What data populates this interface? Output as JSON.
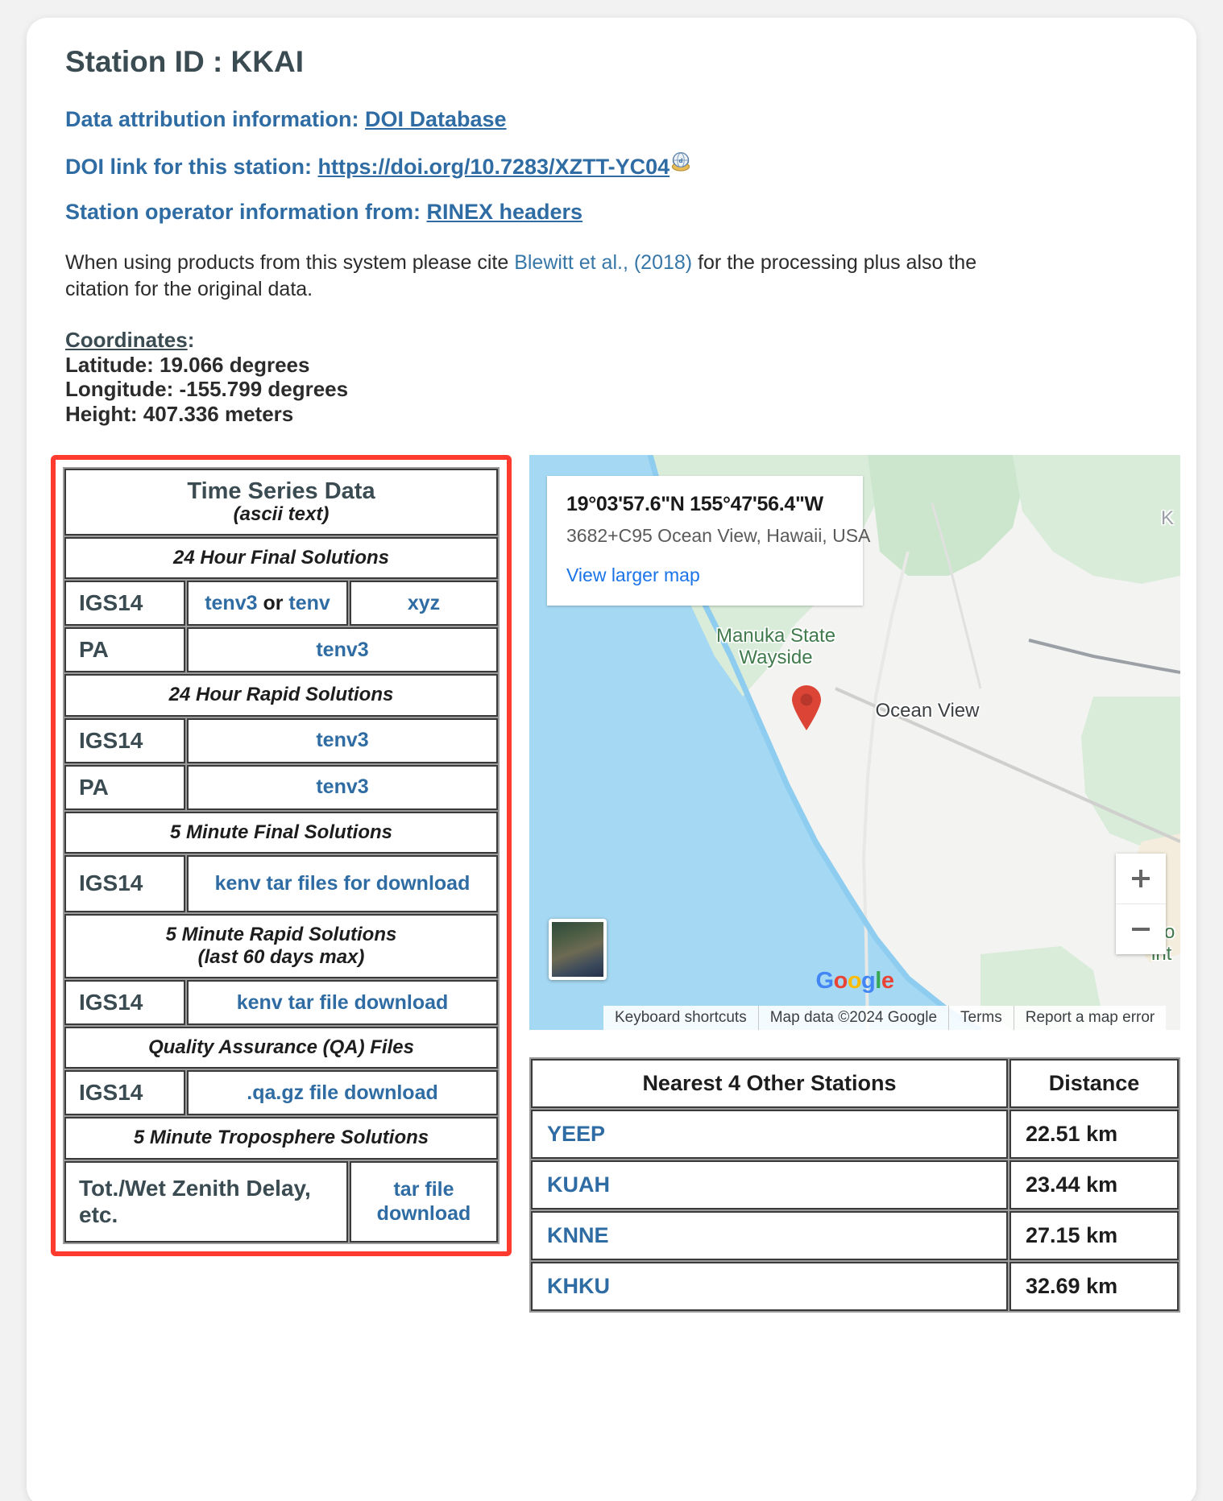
{
  "header": {
    "station_id_label": "Station ID : KKAI"
  },
  "attribution": {
    "data_attribution_prefix": "Data attribution information: ",
    "data_attribution_link": "DOI Database",
    "doi_prefix": "DOI link for this station: ",
    "doi_link": "https://doi.org/10.7283/XZTT-YC04",
    "doi_icon": "doi-globe-icon",
    "operator_prefix": "Station operator information from: ",
    "operator_link": "RINEX headers"
  },
  "citation": {
    "text_before": "When using products from this system please cite ",
    "link": "Blewitt et al., (2018)",
    "text_after": " for the processing plus also the citation for the original data."
  },
  "coordinates": {
    "heading": "Coordinates",
    "heading_colon": ":",
    "latitude": "Latitude: 19.066 degrees",
    "longitude": "Longitude: -155.799 degrees",
    "height": "Height: 407.336 meters"
  },
  "time_series_table": {
    "title": "Time Series Data",
    "subtitle": "(ascii text)",
    "sections": [
      {
        "heading": "24 Hour Final Solutions",
        "rows": [
          {
            "label": "IGS14",
            "cells": [
              "tenv3 or tenv",
              "xyz"
            ]
          },
          {
            "label": "PA",
            "cells": [
              "tenv3"
            ]
          }
        ]
      },
      {
        "heading": "24 Hour Rapid Solutions",
        "rows": [
          {
            "label": "IGS14",
            "cells": [
              "tenv3"
            ]
          },
          {
            "label": "PA",
            "cells": [
              "tenv3"
            ]
          }
        ]
      },
      {
        "heading": "5 Minute Final Solutions",
        "rows": [
          {
            "label": "IGS14",
            "cells": [
              "kenv tar files for download"
            ]
          }
        ]
      },
      {
        "heading": "5 Minute Rapid Solutions\n(last 60 days max)",
        "rows": [
          {
            "label": "IGS14",
            "cells": [
              "kenv tar file download"
            ]
          }
        ]
      },
      {
        "heading": "Quality Assurance (QA) Files",
        "rows": [
          {
            "label": "IGS14",
            "cells": [
              ".qa.gz file download"
            ]
          }
        ]
      },
      {
        "heading": "5 Minute Troposphere Solutions",
        "rows": [
          {
            "label": "Tot./Wet Zenith Delay, etc.",
            "cells": [
              "tar file download"
            ]
          }
        ]
      }
    ],
    "labels": {
      "s1_h": "24 Hour Final Solutions",
      "s1_r1_label": "IGS14",
      "s1_r1_c1_a": "tenv3",
      "s1_r1_c1_or": " or ",
      "s1_r1_c1_b": "tenv",
      "s1_r1_c2": "xyz",
      "s1_r2_label": "PA",
      "s1_r2_c1": "tenv3",
      "s2_h": "24 Hour Rapid Solutions",
      "s2_r1_label": "IGS14",
      "s2_r1_c1": "tenv3",
      "s2_r2_label": "PA",
      "s2_r2_c1": "tenv3",
      "s3_h": "5 Minute Final Solutions",
      "s3_r1_label": "IGS14",
      "s3_r1_c1": "kenv tar files for download",
      "s4_h1": "5 Minute Rapid Solutions",
      "s4_h2": "(last 60 days max)",
      "s4_r1_label": "IGS14",
      "s4_r1_c1": "kenv tar file download",
      "s5_h": "Quality Assurance (QA) Files",
      "s5_r1_label": "IGS14",
      "s5_r1_c1": ".qa.gz file download",
      "s6_h": "5 Minute Troposphere Solutions",
      "s6_r1_label": "Tot./Wet Zenith Delay, etc.",
      "s6_r1_c1": "tar file download"
    }
  },
  "map": {
    "infobox": {
      "coordinates": "19°03'57.6\"N 155°47'56.4\"W",
      "address": "3682+C95 Ocean View, Hawaii, USA",
      "view_larger": "View larger map"
    },
    "labels": {
      "park_line1": "Manuka State",
      "park_line2": "Wayside",
      "town": "Ocean View",
      "right_clip_line1": "So",
      "right_clip_line2": "int",
      "top_right_clip": "K"
    },
    "marker_icon": "map-pin-icon",
    "zoom_in_icon": "plus-icon",
    "zoom_out_icon": "minus-icon",
    "satellite_thumb": "satellite-thumbnail",
    "google_logo": {
      "g1": "G",
      "o1": "o",
      "o2": "o",
      "g2": "g",
      "l": "l",
      "e": "e"
    },
    "footer": {
      "keyboard_shortcuts": "Keyboard shortcuts",
      "map_data": "Map data ©2024 Google",
      "terms": "Terms",
      "report": "Report a map error"
    }
  },
  "nearest_stations": {
    "headers": [
      "Nearest 4 Other Stations",
      "Distance"
    ],
    "rows": [
      {
        "name": "YEEP",
        "distance": "22.51 km"
      },
      {
        "name": "KUAH",
        "distance": "23.44 km"
      },
      {
        "name": "KNNE",
        "distance": "27.15 km"
      },
      {
        "name": "KHKU",
        "distance": "32.69 km"
      }
    ]
  },
  "colors": {
    "link_blue": "#2e6ca3",
    "heading_slate": "#3b4b52",
    "highlight_red": "#ff3b30",
    "map_water": "#a5d8f2",
    "map_green": "#d7ecd9"
  }
}
